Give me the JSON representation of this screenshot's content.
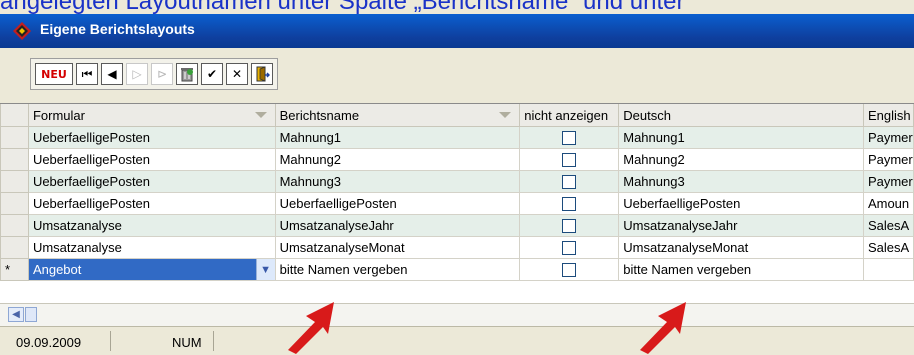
{
  "caption": "angelegten Layoutnamen unter Spalte „Berichtsname“ und unter",
  "window": {
    "title": "Eigene Berichtslayouts"
  },
  "toolbar": {
    "new_label": "NEU",
    "first_symbol": "⏮",
    "prev_symbol": "◀",
    "next_symbol": "▷",
    "last_symbol": "⊳",
    "delete_symbol": "🗑",
    "ok_symbol": "✔",
    "cancel_symbol": "✕",
    "exit_symbol": "⇥"
  },
  "grid": {
    "columns": [
      "Formular",
      "Berichtsname",
      "nicht anzeigen",
      "Deutsch",
      "English"
    ],
    "rows": [
      {
        "formular": "UeberfaelligePosten",
        "berichtsname": "Mahnung1",
        "nicht_anzeigen": false,
        "deutsch": "Mahnung1",
        "english": "Paymer"
      },
      {
        "formular": "UeberfaelligePosten",
        "berichtsname": "Mahnung2",
        "nicht_anzeigen": false,
        "deutsch": "Mahnung2",
        "english": "Paymer"
      },
      {
        "formular": "UeberfaelligePosten",
        "berichtsname": "Mahnung3",
        "nicht_anzeigen": false,
        "deutsch": "Mahnung3",
        "english": "Paymer"
      },
      {
        "formular": "UeberfaelligePosten",
        "berichtsname": "UeberfaelligePosten",
        "nicht_anzeigen": false,
        "deutsch": "UeberfaelligePosten",
        "english": "Amoun"
      },
      {
        "formular": "Umsatzanalyse",
        "berichtsname": "UmsatzanalyseJahr",
        "nicht_anzeigen": false,
        "deutsch": "UmsatzanalyseJahr",
        "english": "SalesA"
      },
      {
        "formular": "Umsatzanalyse",
        "berichtsname": "UmsatzanalyseMonat",
        "nicht_anzeigen": false,
        "deutsch": "UmsatzanalyseMonat",
        "english": "SalesA"
      }
    ],
    "new_row": {
      "marker": "*",
      "formular": "Angebot",
      "berichtsname": "bitte Namen vergeben",
      "deutsch": "bitte Namen vergeben",
      "english": ""
    }
  },
  "status": {
    "date": "09.09.2009",
    "num": "NUM"
  },
  "colors": {
    "title_bar": "#0f3f9e",
    "selection": "#316ac5",
    "alt_row": "#e5efe9",
    "annotation_arrow": "#d81a1a",
    "caption_text": "#1a32c8"
  }
}
